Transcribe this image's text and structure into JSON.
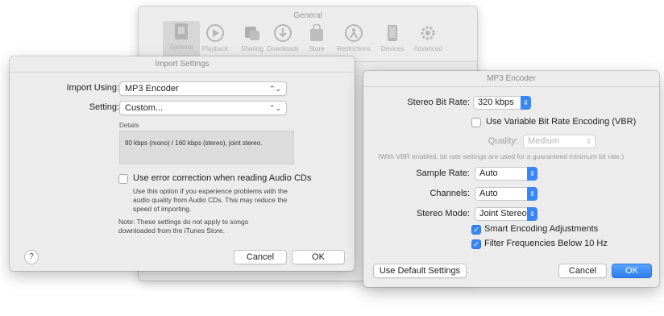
{
  "general": {
    "title": "General",
    "toolbar": [
      {
        "label": "General",
        "icon": "general-icon"
      },
      {
        "label": "Playback",
        "icon": "play-icon"
      },
      {
        "label": "Sharing",
        "icon": "sharing-icon"
      },
      {
        "label": "Downloads",
        "icon": "download-icon"
      },
      {
        "label": "Store",
        "icon": "store-icon"
      },
      {
        "label": "Restrictions",
        "icon": "restrictions-icon"
      },
      {
        "label": "Devices",
        "icon": "device-icon"
      },
      {
        "label": "Advanced",
        "icon": "gear-icon"
      }
    ]
  },
  "import_settings": {
    "title": "Import Settings",
    "import_using_label": "Import Using:",
    "import_using_value": "MP3 Encoder",
    "setting_label": "Setting:",
    "setting_value": "Custom...",
    "details_label": "Details",
    "details_text": "80 kbps (mono) / 160 kbps (stereo), joint stereo.",
    "error_correction_label": "Use error correction when reading Audio CDs",
    "error_correction_help": "Use this option if you experience problems with the audio quality from Audio CDs. This may reduce the speed of importing.",
    "note": "Note: These settings do not apply to songs downloaded from the iTunes Store.",
    "help_glyph": "?",
    "cancel_label": "Cancel",
    "ok_label": "OK"
  },
  "mp3_encoder": {
    "title": "MP3 Encoder",
    "stereo_bit_rate_label": "Stereo Bit Rate:",
    "stereo_bit_rate_value": "320 kbps",
    "vbr_label": "Use Variable Bit Rate Encoding (VBR)",
    "quality_label": "Quality:",
    "quality_value": "Medium",
    "vbr_note": "(With VBR enabled, bit rate settings are used for a guaranteed minimum bit rate.)",
    "sample_rate_label": "Sample Rate:",
    "sample_rate_value": "Auto",
    "channels_label": "Channels:",
    "channels_value": "Auto",
    "stereo_mode_label": "Stereo Mode:",
    "stereo_mode_value": "Joint Stereo",
    "smart_encoding_label": "Smart Encoding Adjustments",
    "filter_label": "Filter Frequencies Below 10 Hz",
    "use_default_label": "Use Default Settings",
    "cancel_label": "Cancel",
    "ok_label": "OK"
  },
  "colors": {
    "accent": "#3a86f6",
    "window_bg": "#ececec"
  }
}
